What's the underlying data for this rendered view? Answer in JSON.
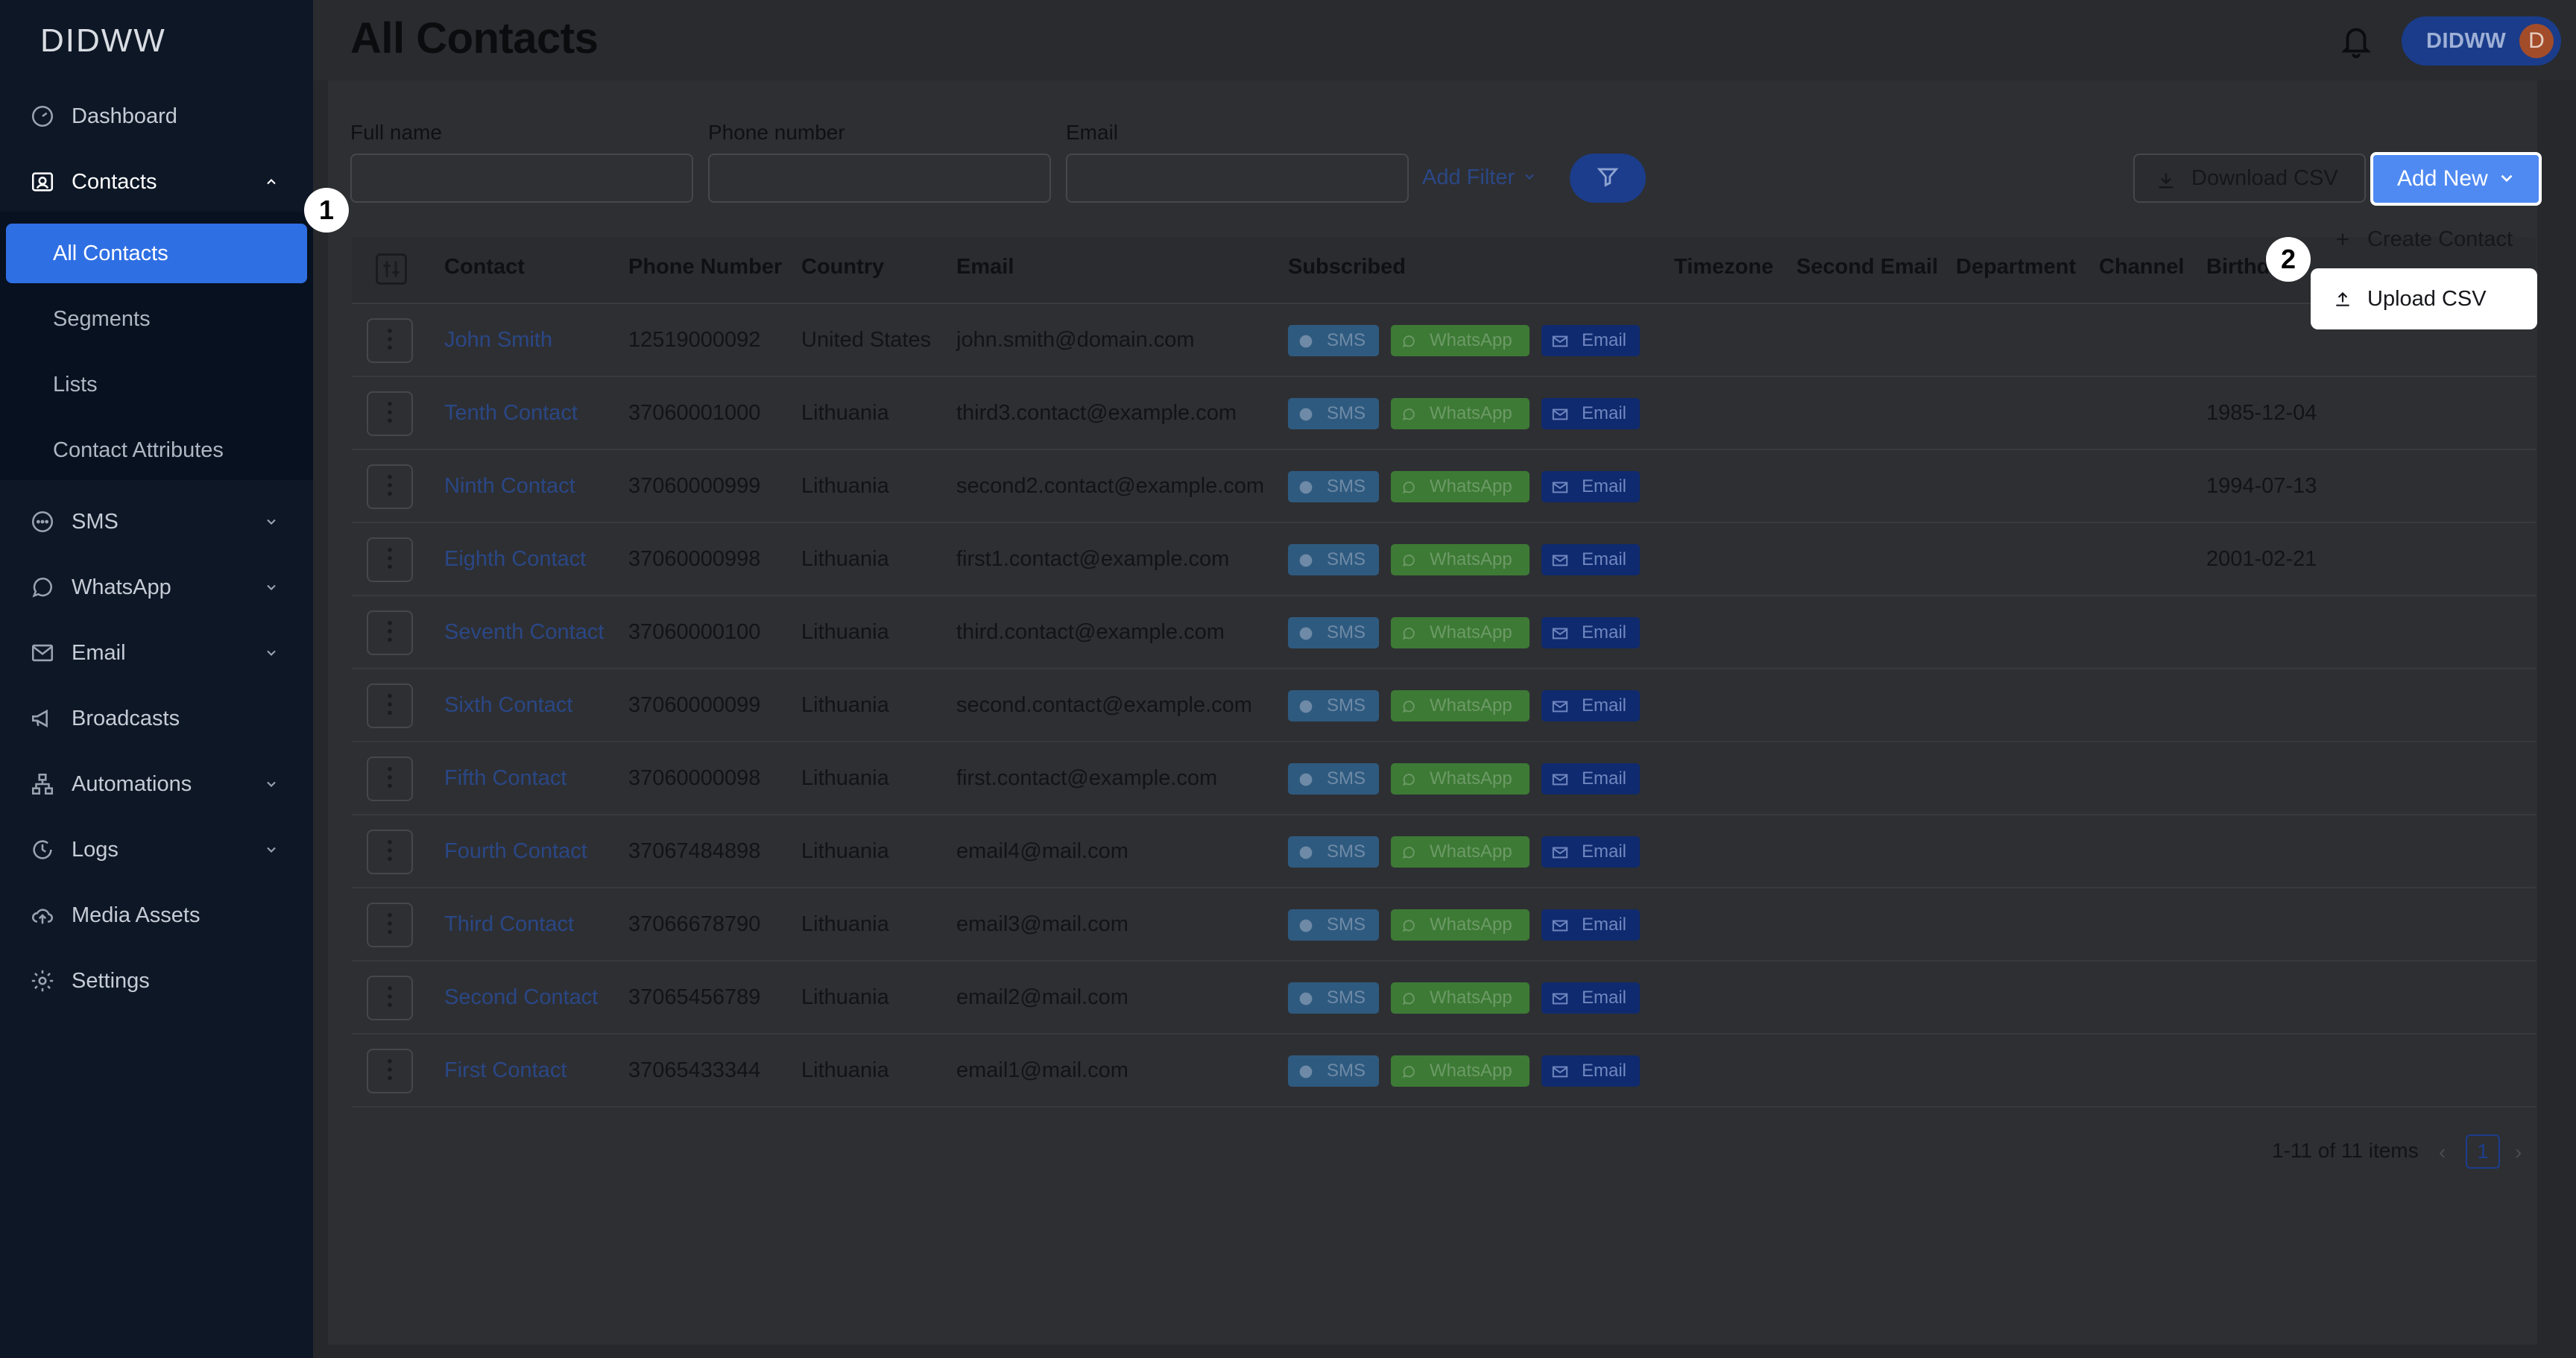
{
  "app": {
    "logo": "DIDWW",
    "page_title": "All Contacts"
  },
  "user": {
    "name": "DIDWW",
    "initial": "D"
  },
  "sidebar": {
    "items": [
      {
        "key": "dashboard",
        "label": "Dashboard",
        "icon": "dashboard-icon"
      },
      {
        "key": "contacts",
        "label": "Contacts",
        "icon": "contacts-icon",
        "expanded": true
      },
      {
        "key": "sms",
        "label": "SMS",
        "icon": "sms-icon"
      },
      {
        "key": "whatsapp",
        "label": "WhatsApp",
        "icon": "whatsapp-icon"
      },
      {
        "key": "email",
        "label": "Email",
        "icon": "mail-icon"
      },
      {
        "key": "broadcasts",
        "label": "Broadcasts",
        "icon": "megaphone-icon"
      },
      {
        "key": "automations",
        "label": "Automations",
        "icon": "flow-icon"
      },
      {
        "key": "logs",
        "label": "Logs",
        "icon": "clock-icon"
      },
      {
        "key": "media",
        "label": "Media Assets",
        "icon": "cloud-upload-icon"
      },
      {
        "key": "settings",
        "label": "Settings",
        "icon": "gear-icon"
      }
    ],
    "contacts_sub": [
      "All Contacts",
      "Segments",
      "Lists",
      "Contact Attributes"
    ]
  },
  "filters": {
    "full_name_label": "Full name",
    "phone_label": "Phone number",
    "email_label": "Email",
    "add_filter": "Add Filter"
  },
  "toolbar": {
    "download_csv": "Download CSV",
    "add_new": "Add New"
  },
  "dropdown": {
    "create_contact": "Create Contact",
    "upload_csv": "Upload CSV"
  },
  "table": {
    "columns": [
      "Contact",
      "Phone Number",
      "Country",
      "Email",
      "Subscribed",
      "Timezone",
      "Second Email",
      "Department",
      "Channel",
      "Birthda"
    ],
    "badges": {
      "sms": "SMS",
      "whatsapp": "WhatsApp",
      "email": "Email"
    },
    "rows": [
      {
        "name": "John Smith",
        "phone": "12519000092",
        "country": "United States",
        "email": "john.smith@domain.com",
        "birthday": ""
      },
      {
        "name": "Tenth Contact",
        "phone": "37060001000",
        "country": "Lithuania",
        "email": "third3.contact@example.com",
        "birthday": "1985-12-04"
      },
      {
        "name": "Ninth Contact",
        "phone": "37060000999",
        "country": "Lithuania",
        "email": "second2.contact@example.com",
        "birthday": "1994-07-13"
      },
      {
        "name": "Eighth Contact",
        "phone": "37060000998",
        "country": "Lithuania",
        "email": "first1.contact@example.com",
        "birthday": "2001-02-21"
      },
      {
        "name": "Seventh Contact",
        "phone": "37060000100",
        "country": "Lithuania",
        "email": "third.contact@example.com",
        "birthday": ""
      },
      {
        "name": "Sixth Contact",
        "phone": "37060000099",
        "country": "Lithuania",
        "email": "second.contact@example.com",
        "birthday": ""
      },
      {
        "name": "Fifth Contact",
        "phone": "37060000098",
        "country": "Lithuania",
        "email": "first.contact@example.com",
        "birthday": ""
      },
      {
        "name": "Fourth Contact",
        "phone": "37067484898",
        "country": "Lithuania",
        "email": "email4@mail.com",
        "birthday": ""
      },
      {
        "name": "Third Contact",
        "phone": "37066678790",
        "country": "Lithuania",
        "email": "email3@mail.com",
        "birthday": ""
      },
      {
        "name": "Second Contact",
        "phone": "37065456789",
        "country": "Lithuania",
        "email": "email2@mail.com",
        "birthday": ""
      },
      {
        "name": "First Contact",
        "phone": "37065433344",
        "country": "Lithuania",
        "email": "email1@mail.com",
        "birthday": ""
      }
    ]
  },
  "pagination": {
    "summary": "1-11 of 11 items",
    "current": "1"
  },
  "steps": [
    "1",
    "2"
  ]
}
